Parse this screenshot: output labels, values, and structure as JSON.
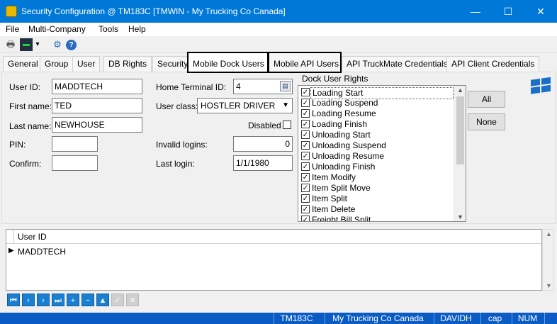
{
  "window": {
    "title": "Security Configuration @ TM183C [TMWIN - My Trucking Co Canada]",
    "controls": {
      "minimize": "—",
      "maximize": "☐",
      "close": "✕"
    }
  },
  "menu": [
    "File",
    "Multi-Company",
    "Tools",
    "Help"
  ],
  "toolbar": {
    "icons": [
      "printer-icon",
      "monitor-icon",
      "dropdown-arrow-icon",
      "settings-gear-icon",
      "help-icon"
    ],
    "glyphs": {
      "print": "🖶",
      "monitor": "▬",
      "dropdown": "▾",
      "gear": "⚙",
      "help": "?"
    }
  },
  "tabs": [
    {
      "label": "General"
    },
    {
      "label": "Group"
    },
    {
      "label": "User"
    },
    {
      "label": "DB Rights"
    },
    {
      "label": "Security"
    },
    {
      "label": "Mobile Dock Users"
    },
    {
      "label": "Mobile API Users"
    },
    {
      "label": "API TruckMate Credentials"
    },
    {
      "label": "API Client Credentials"
    }
  ],
  "form": {
    "user_id": {
      "label": "User ID:",
      "value": "MADDTECH"
    },
    "first_name": {
      "label": "First name:",
      "value": "TED"
    },
    "last_name": {
      "label": "Last name:",
      "value": "NEWHOUSE"
    },
    "pin": {
      "label": "PIN:",
      "value": ""
    },
    "confirm": {
      "label": "Confirm:",
      "value": ""
    },
    "home_terminal": {
      "label": "Home Terminal ID:",
      "value": "4"
    },
    "user_class": {
      "label": "User class:",
      "value": "HOSTLER DRIVER"
    },
    "disabled": {
      "label": "Disabled",
      "checked": false
    },
    "invalid_logins": {
      "label": "Invalid logins:",
      "value": "0"
    },
    "last_login": {
      "label": "Last login:",
      "value": "1/1/1980"
    }
  },
  "rights": {
    "title": "Dock User Rights",
    "items": [
      {
        "label": "Loading Start",
        "checked": true
      },
      {
        "label": "Loading Suspend",
        "checked": true
      },
      {
        "label": "Loading Resume",
        "checked": true
      },
      {
        "label": "Loading Finish",
        "checked": true
      },
      {
        "label": "Unloading Start",
        "checked": true
      },
      {
        "label": "Unloading Suspend",
        "checked": true
      },
      {
        "label": "Unloading Resume",
        "checked": true
      },
      {
        "label": "Unloading Finish",
        "checked": true
      },
      {
        "label": "Item Modify",
        "checked": true
      },
      {
        "label": "Item Split Move",
        "checked": true
      },
      {
        "label": "Item Split",
        "checked": true
      },
      {
        "label": "Item Delete",
        "checked": true
      },
      {
        "label": "Freight Bill Split",
        "checked": true
      }
    ],
    "all_label": "All",
    "none_label": "None"
  },
  "grid": {
    "column": "User ID",
    "rows": [
      {
        "user_id": "MADDTECH"
      }
    ]
  },
  "status": [
    "TM183C",
    "My Trucking Co Canada",
    "DAVIDH",
    "cap",
    "NUM"
  ],
  "colors": {
    "titlebar": "#0078d7",
    "statusbar": "#0a5cc4",
    "nav_button": "#1a7fd1"
  }
}
